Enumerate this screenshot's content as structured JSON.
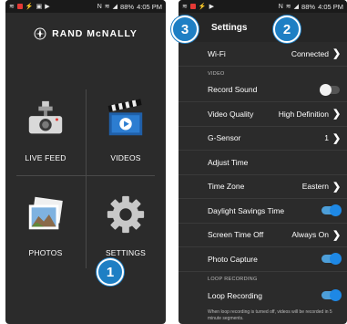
{
  "status_bar": {
    "battery": "88%",
    "time": "4:05 PM"
  },
  "home": {
    "brand": "RAND McNALLY",
    "tiles": [
      {
        "label": "LIVE FEED",
        "icon": "camera-icon"
      },
      {
        "label": "VIDEOS",
        "icon": "clapperboard-icon"
      },
      {
        "label": "PHOTOS",
        "icon": "photo-icon"
      },
      {
        "label": "SETTINGS",
        "icon": "gear-icon"
      }
    ]
  },
  "settings": {
    "title": "Settings",
    "rows": {
      "wifi": {
        "label": "Wi-Fi",
        "value": "Connected"
      },
      "video_section": "VIDEO",
      "record_sound": {
        "label": "Record Sound",
        "state": "off"
      },
      "video_quality": {
        "label": "Video Quality",
        "value": "High Definition"
      },
      "gsensor": {
        "label": "G-Sensor",
        "value": "1"
      },
      "adjust_time": {
        "label": "Adjust Time"
      },
      "time_zone": {
        "label": "Time Zone",
        "value": "Eastern"
      },
      "dst": {
        "label": "Daylight Savings Time",
        "state": "on"
      },
      "screen_time_off": {
        "label": "Screen Time Off",
        "value": "Always On"
      },
      "photo_capture": {
        "label": "Photo Capture",
        "state": "on"
      },
      "loop_section": "LOOP RECORDING",
      "loop_recording": {
        "label": "Loop Recording",
        "state": "on"
      },
      "loop_note": "When loop recording is turned off, videos will be recorded in 5 minute segments."
    }
  },
  "callouts": {
    "one": "1",
    "two": "2",
    "three": "3"
  },
  "colors": {
    "accent": "#1e88e5",
    "callout": "#1e7fc4",
    "background": "#2b2b2b"
  }
}
